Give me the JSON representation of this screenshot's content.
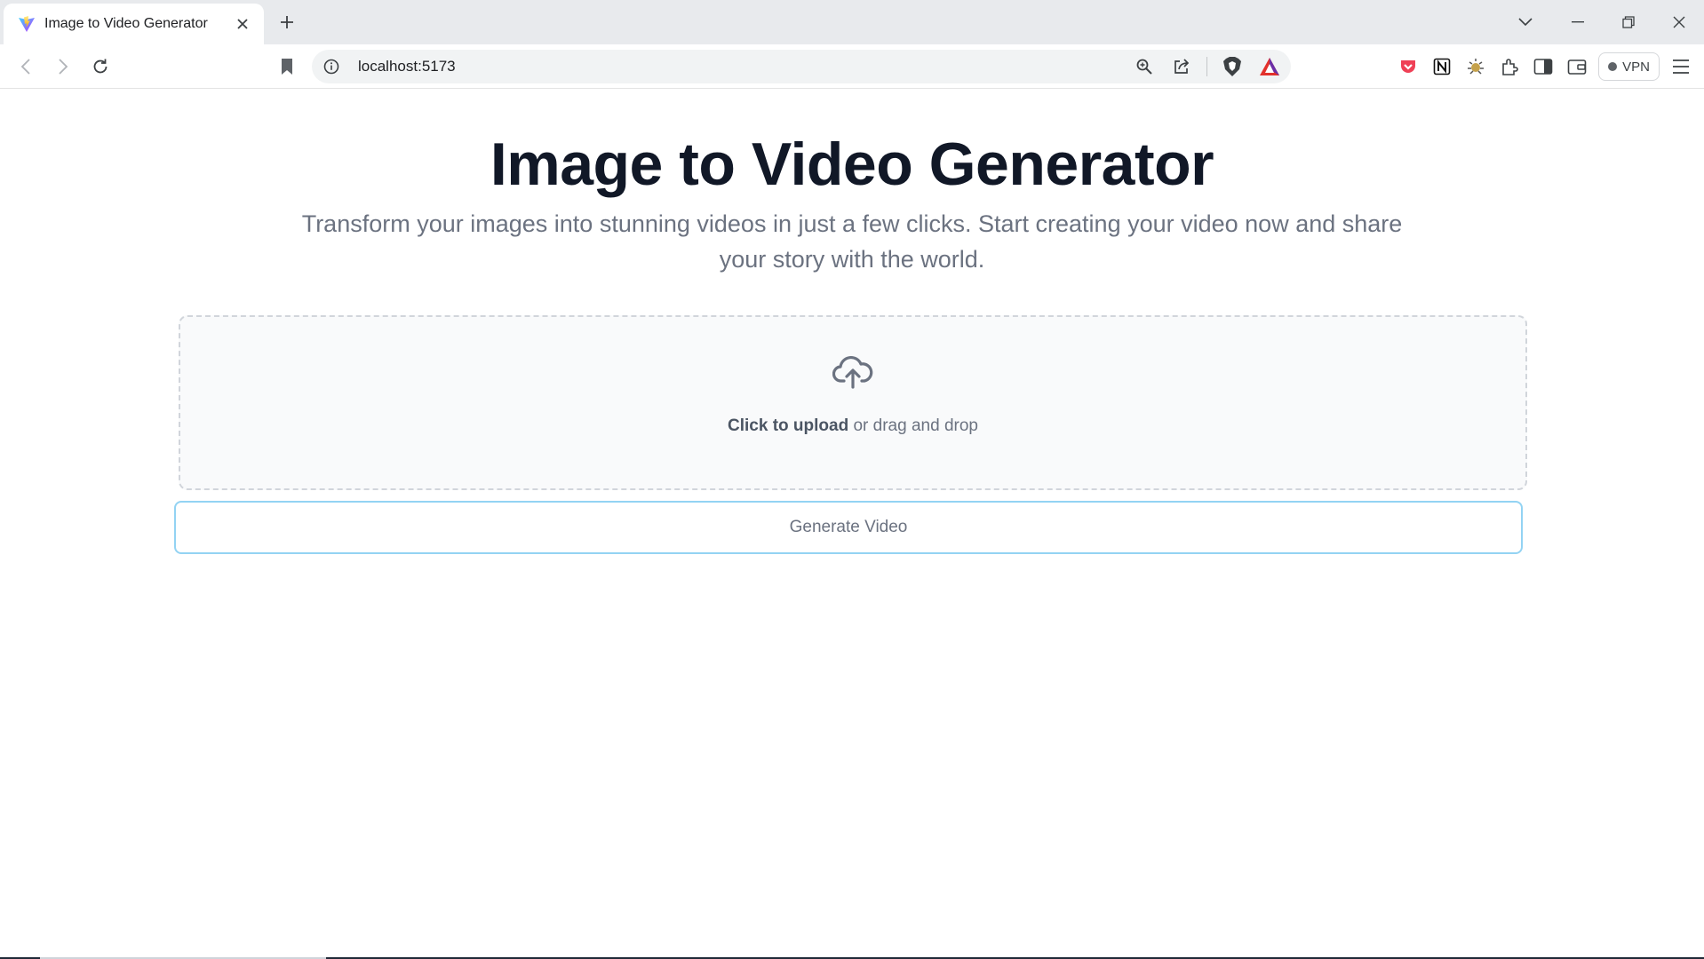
{
  "browser": {
    "tab": {
      "title": "Image to Video Generator",
      "favicon": "vite-logo-icon"
    },
    "address": {
      "url": "localhost:5173"
    },
    "vpn_label": "VPN",
    "icons": [
      "back-icon",
      "forward-icon",
      "reload-icon",
      "bookmark-icon",
      "site-info-icon",
      "zoom-icon",
      "share-icon",
      "brave-shield-icon",
      "brave-rewards-icon",
      "pocket-icon",
      "notion-icon",
      "extension-bug-icon",
      "extensions-icon",
      "sidebar-icon",
      "wallet-icon",
      "menu-icon",
      "minimize-icon",
      "restore-icon",
      "close-window-icon",
      "tab-list-icon",
      "new-tab-icon"
    ],
    "colors": {
      "pocket": "#ef4056",
      "brave_rewards": "#e2312c"
    }
  },
  "page": {
    "title": "Image to Video Generator",
    "subtitle": "Transform your images into stunning videos in just a few clicks. Start creating your video now and share your story with the world.",
    "upload": {
      "strong": "Click to upload",
      "rest": " or drag and drop"
    },
    "generate_label": "Generate Video",
    "colors": {
      "accent_border": "#93d3f3"
    }
  }
}
